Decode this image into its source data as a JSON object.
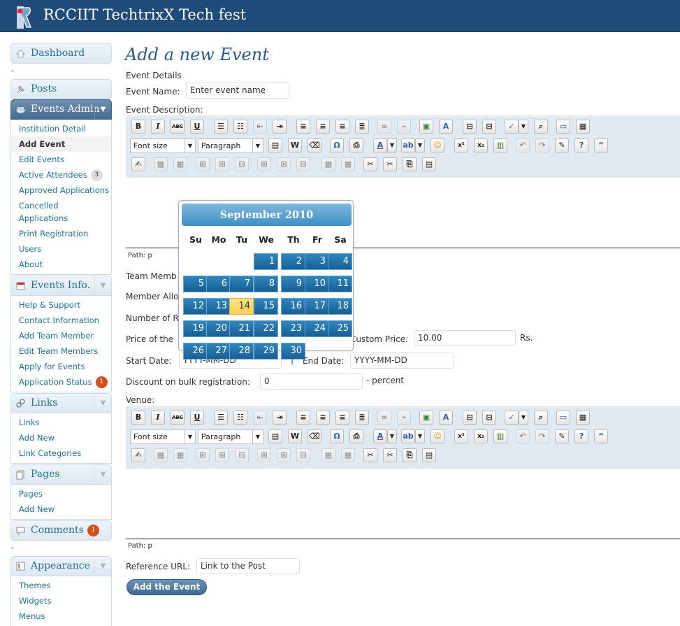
{
  "header": {
    "site_title": "RCCIIT TechtrixX Tech fest"
  },
  "menu": {
    "dashboard": "Dashboard",
    "posts": "Posts",
    "events_admin": {
      "label": "Events Admin",
      "items": [
        "Institution Detail",
        "Add Event",
        "Edit Events",
        "Active Attendees",
        "Approved Applications",
        "Cancelled Applications",
        "Print Registration",
        "Users",
        "About"
      ],
      "attendees_count": "3"
    },
    "events_info": {
      "label": "Events Info.",
      "items": [
        "Help & Support",
        "Contact Information",
        "Add Team Member",
        "Edit Team Members",
        "Apply for Events",
        "Application Status"
      ],
      "status_count": "1"
    },
    "links": {
      "label": "Links",
      "items": [
        "Links",
        "Add New",
        "Link Categories"
      ]
    },
    "pages": {
      "label": "Pages",
      "items": [
        "Pages",
        "Add New"
      ]
    },
    "comments": {
      "label": "Comments",
      "count": "1"
    },
    "appearance": {
      "label": "Appearance",
      "items": [
        "Themes",
        "Widgets",
        "Menus"
      ]
    }
  },
  "form": {
    "title": "Add a new Event",
    "section": "Event Details",
    "event_name_label": "Event Name:",
    "event_name_value": "Enter event name",
    "description_label": "Event Description:",
    "path_label": "Path: p",
    "team_members_label": "Team Memb",
    "member_allowed_label": "Member Allo",
    "number_label": "Number of R",
    "price_label": "Price of the",
    "custom_price_label": "Custom Price:",
    "custom_price_value": "10.00",
    "currency": "Rs.",
    "start_date_label": "Start Date:",
    "start_date_value": "YYYY-MM-DD",
    "divider": "|",
    "end_date_label": "End Date:",
    "end_date_value": "YYYY-MM-DD",
    "discount_label": "Discount on bulk registration:",
    "discount_value": "0",
    "discount_suffix": "- percent",
    "venue_label": "Venue:",
    "reference_label": "Reference URL:",
    "reference_value": "Link to the Post",
    "submit_label": "Add the Event"
  },
  "editor_toolbar": {
    "bold": "B",
    "italic": "I",
    "strike": "ABC",
    "underline": "U",
    "font_size": "Font size",
    "format": "Paragraph",
    "omega": "Ω",
    "text_color": "A",
    "superscript": "x²",
    "subscript": "x₂",
    "quote": "“"
  },
  "calendar": {
    "month": "September 2010",
    "weekdays": [
      "Su",
      "Mo",
      "Tu",
      "We",
      "Th",
      "Fr",
      "Sa"
    ],
    "days": [
      "1",
      "2",
      "3",
      "4",
      "5",
      "6",
      "7",
      "8",
      "9",
      "10",
      "11",
      "12",
      "13",
      "14",
      "15",
      "16",
      "17",
      "18",
      "19",
      "20",
      "21",
      "22",
      "23",
      "24",
      "25",
      "26",
      "27",
      "28",
      "29",
      "30"
    ],
    "today": "14"
  },
  "colors": {
    "header_bg": "#1e4b78",
    "link": "#21759b",
    "calendar_day": "#1f6fa6",
    "today": "#f9d866",
    "badge": "#d54e21"
  }
}
